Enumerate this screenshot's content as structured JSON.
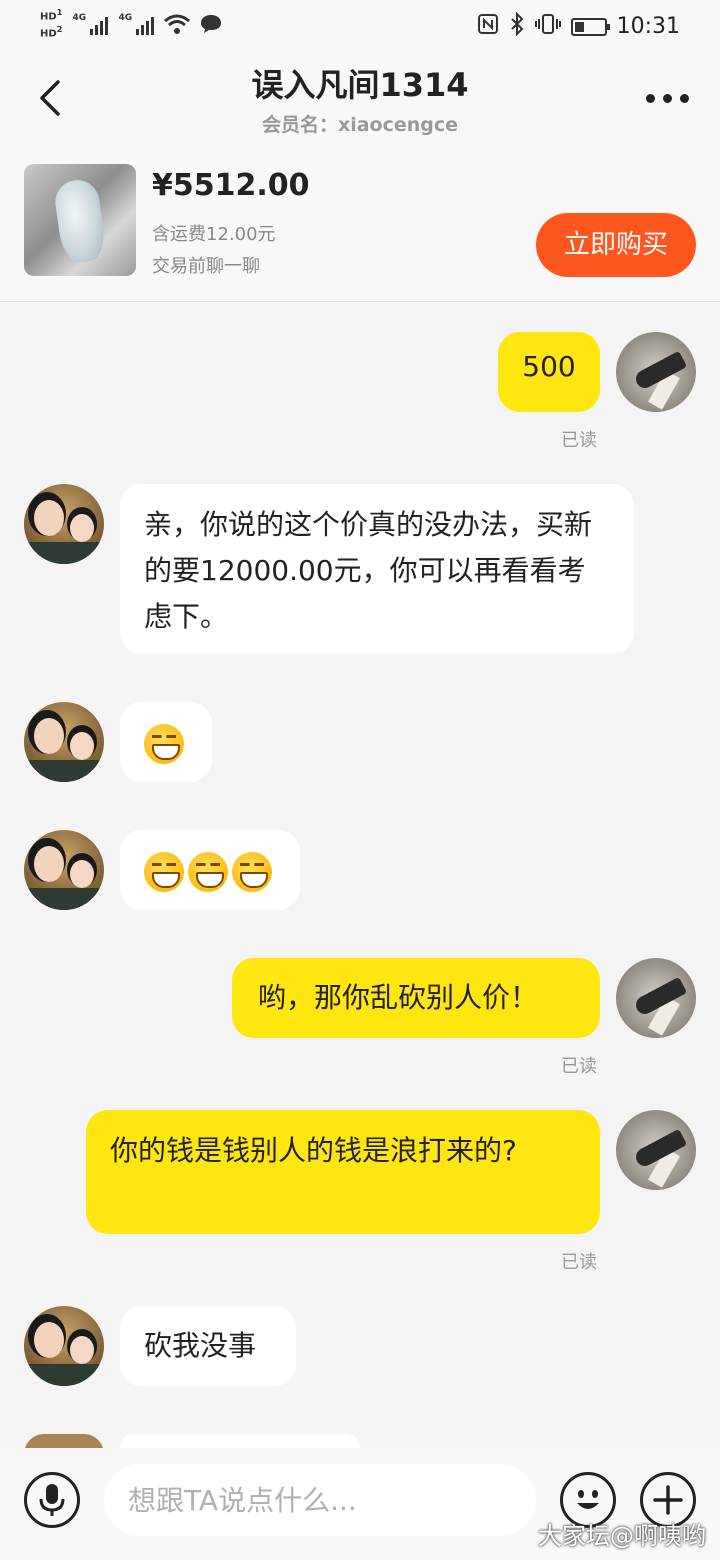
{
  "status_bar": {
    "hd1": "HD",
    "hd2": "HD",
    "sim1_badge": "1",
    "sim2_badge": "2",
    "net1": "4G",
    "net2": "4G",
    "time": "10:31",
    "battery_level": 0.35,
    "icons": [
      "nfc-icon",
      "bluetooth-icon",
      "vibrate-icon",
      "wifi-icon",
      "message-notification-icon"
    ]
  },
  "header": {
    "title": "误入凡间1314",
    "subtitle": "会员名：xiaocengce"
  },
  "product": {
    "price": "¥5512.00",
    "shipping": "含运费12.00元",
    "note": "交易前聊一聊",
    "buy_label": "立即购买"
  },
  "messages": [
    {
      "from": "me",
      "text": "500",
      "status": "已读"
    },
    {
      "from": "them",
      "text": "亲，你说的这个价真的没办法，买新的要12000.00元，你可以再看看考虑下。"
    },
    {
      "from": "them",
      "emoji_count": 1,
      "emoji": "grin-squint-emoji"
    },
    {
      "from": "them",
      "emoji_count": 3,
      "emoji": "grin-squint-emoji"
    },
    {
      "from": "me",
      "text": "哟，那你乱砍别人价！",
      "status": "已读"
    },
    {
      "from": "me",
      "text": "你的钱是钱别人的钱是浪打来的?",
      "status": "已读"
    },
    {
      "from": "them",
      "text": "砍我没事"
    }
  ],
  "input": {
    "placeholder": "想跟TA说点什么..."
  },
  "watermark": "大家坛@啊咦哟"
}
